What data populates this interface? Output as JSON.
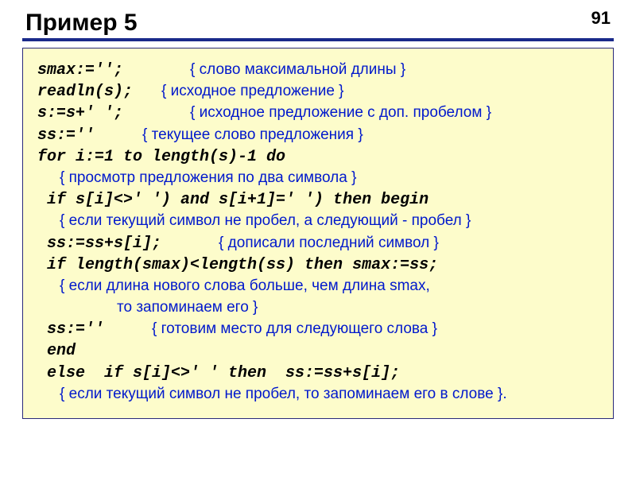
{
  "page_number": "91",
  "title": "Пример 5",
  "lines": {
    "l1_code": "smax:='';",
    "l1_cmt": "{ слово максимальной длины }",
    "l2_code": "readln(s);",
    "l2_cmt": "{ исходное предложение }",
    "l3_code": "s:=s+' ';",
    "l3_cmt": "{ исходное предложение с доп. пробелом }",
    "l4_code": "ss:=''",
    "l4_cmt": "{ текущее слово предложения }",
    "l5_code": "for i:=1 to length(s)-1 do",
    "l6_cmt": "{ просмотр предложения по два символа }",
    "l7_code": " if s[i]<>' ') and s[i+1]=' ') then begin",
    "l8_cmt": "{ если текущий символ не пробел, а следующий - пробел }",
    "l9_code": " ss:=ss+s[i];",
    "l9_cmt": "{ дописали последний символ }",
    "l10_code": " if length(smax)<length(ss) then smax:=ss;",
    "l11_cmt_a": "{ если длина нового слова больше, чем длина smax,",
    "l11_cmt_b": "то запоминаем его }",
    "l12_code": " ss:=''",
    "l12_cmt": "{ готовим место для следующего слова }",
    "l13_code": " end",
    "l14_code": " else  if s[i]<>' ' then  ss:=ss+s[i];",
    "l15_cmt": "{ если текущий символ не пробел, то запоминаем его в слове }."
  }
}
